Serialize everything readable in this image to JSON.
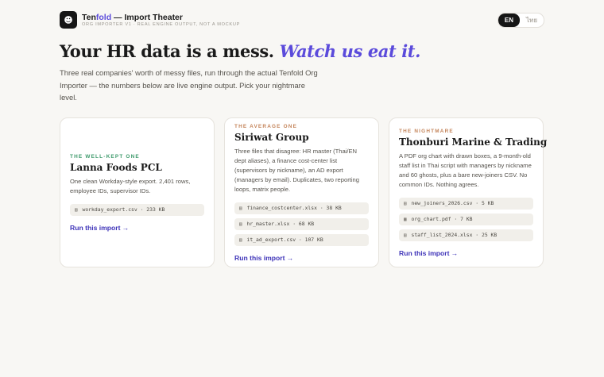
{
  "header": {
    "logo_glyph": "☻",
    "brand_part1": "Ten",
    "brand_part2": "fold",
    "brand_rest": " — Import Theater",
    "tagline": "ORG IMPORTER V1 · REAL ENGINE OUTPUT, NOT A MOCKUP",
    "lang_en": "EN",
    "lang_th": "ไทย"
  },
  "hero": {
    "headline_plain": "Your HR data is a mess. ",
    "headline_em": "Watch us eat it.",
    "intro": "Three real companies' worth of messy files, run through the actual Tenfold Org Importer — the numbers below are live engine output. Pick your nightmare level."
  },
  "cards": [
    {
      "tier": "THE WELL-KEPT ONE",
      "title": "Lanna Foods PCL",
      "desc": "One clean Workday-style export. 2,401 rows, employee IDs, supervisor IDs.",
      "files": [
        {
          "name": "workday_export.csv",
          "size": "233 KB"
        }
      ],
      "run": "Run this import",
      "color": "#3d9a6b"
    },
    {
      "tier": "THE AVERAGE ONE",
      "title": "Siriwat Group",
      "desc": "Three files that disagree: HR master (Thai/EN dept aliases), a finance cost-center list (supervisors by nickname), an AD export (managers by email). Duplicates, two reporting loops, matrix people.",
      "files": [
        {
          "name": "finance_costcenter.xlsx",
          "size": "38 KB"
        },
        {
          "name": "hr_master.xlsx",
          "size": "68 KB"
        },
        {
          "name": "it_ad_export.csv",
          "size": "107 KB"
        }
      ],
      "run": "Run this import",
      "color": "#c4845a"
    },
    {
      "tier": "THE NIGHTMARE",
      "title": "Thonburi Marine & Trading",
      "desc": "A PDF org chart with drawn boxes, a 9-month-old staff list in Thai script with managers by nickname and 60 ghosts, plus a bare new-joiners CSV. No common IDs. Nothing agrees.",
      "files": [
        {
          "name": "new_joiners_2026.csv",
          "size": "5 KB"
        },
        {
          "name": "org_chart.pdf",
          "size": "7 KB"
        },
        {
          "name": "staff_list_2024.xlsx",
          "size": "25 KB"
        }
      ],
      "run": "Run this import",
      "color": "#c4845a"
    }
  ],
  "ui": {
    "file_sep": " · ",
    "run_arrow": "→",
    "accent_color": "#5b4bdb"
  }
}
